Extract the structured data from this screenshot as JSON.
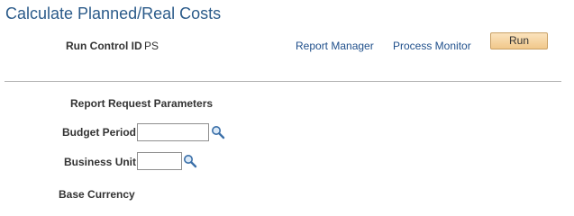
{
  "page": {
    "title": "Calculate Planned/Real Costs"
  },
  "run_control": {
    "label": "Run Control ID",
    "value": "PS"
  },
  "links": {
    "report_manager": "Report Manager",
    "process_monitor": "Process Monitor"
  },
  "run_button": {
    "label": "Run"
  },
  "params": {
    "section_title": "Report Request Parameters",
    "budget_period": {
      "label": "Budget Period",
      "value": ""
    },
    "business_unit": {
      "label": "Business Unit",
      "value": ""
    },
    "base_currency": {
      "label": "Base Currency"
    }
  },
  "icons": {
    "lookup": "magnifier-lookup-icon"
  },
  "colors": {
    "title": "#2b5b8a",
    "link": "#1f4f8b",
    "button_fill": "#f1c88b",
    "divider": "#b5b5b5"
  }
}
